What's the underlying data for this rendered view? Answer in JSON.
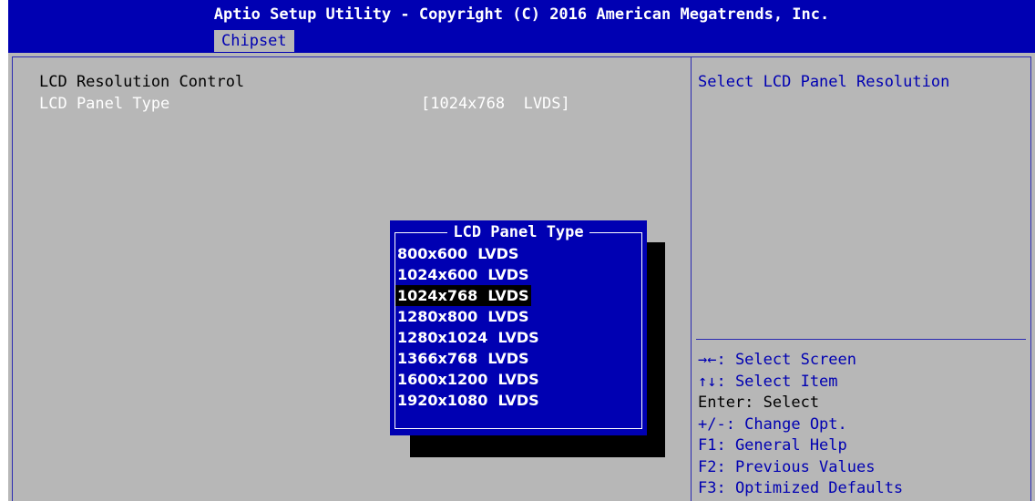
{
  "header": {
    "title": "Aptio Setup Utility - Copyright (C) 2016 American Megatrends, Inc.",
    "active_tab": "Chipset"
  },
  "main": {
    "section_label": "LCD Resolution Control",
    "setting_label": "LCD Panel Type",
    "setting_value": "[1024x768  LVDS]"
  },
  "help": {
    "description": "Select LCD Panel Resolution",
    "keys": [
      "→←: Select Screen",
      "↑↓: Select Item",
      "Enter: Select",
      "+/-: Change Opt.",
      "F1: General Help",
      "F2: Previous Values",
      "F3: Optimized Defaults"
    ]
  },
  "popup": {
    "title": "LCD Panel Type",
    "options": [
      "800x600  LVDS",
      "1024x600  LVDS",
      "1024x768  LVDS",
      "1280x800  LVDS",
      "1280x1024  LVDS",
      "1366x768  LVDS",
      "1600x1200  LVDS",
      "1920x1080  LVDS"
    ],
    "selected_option": "1024x768  LVDS"
  },
  "colors": {
    "bios_blue": "#0000b2",
    "panel_gray": "#b7b7b7",
    "highlight_white": "#ffffff",
    "selection_black": "#000000"
  }
}
